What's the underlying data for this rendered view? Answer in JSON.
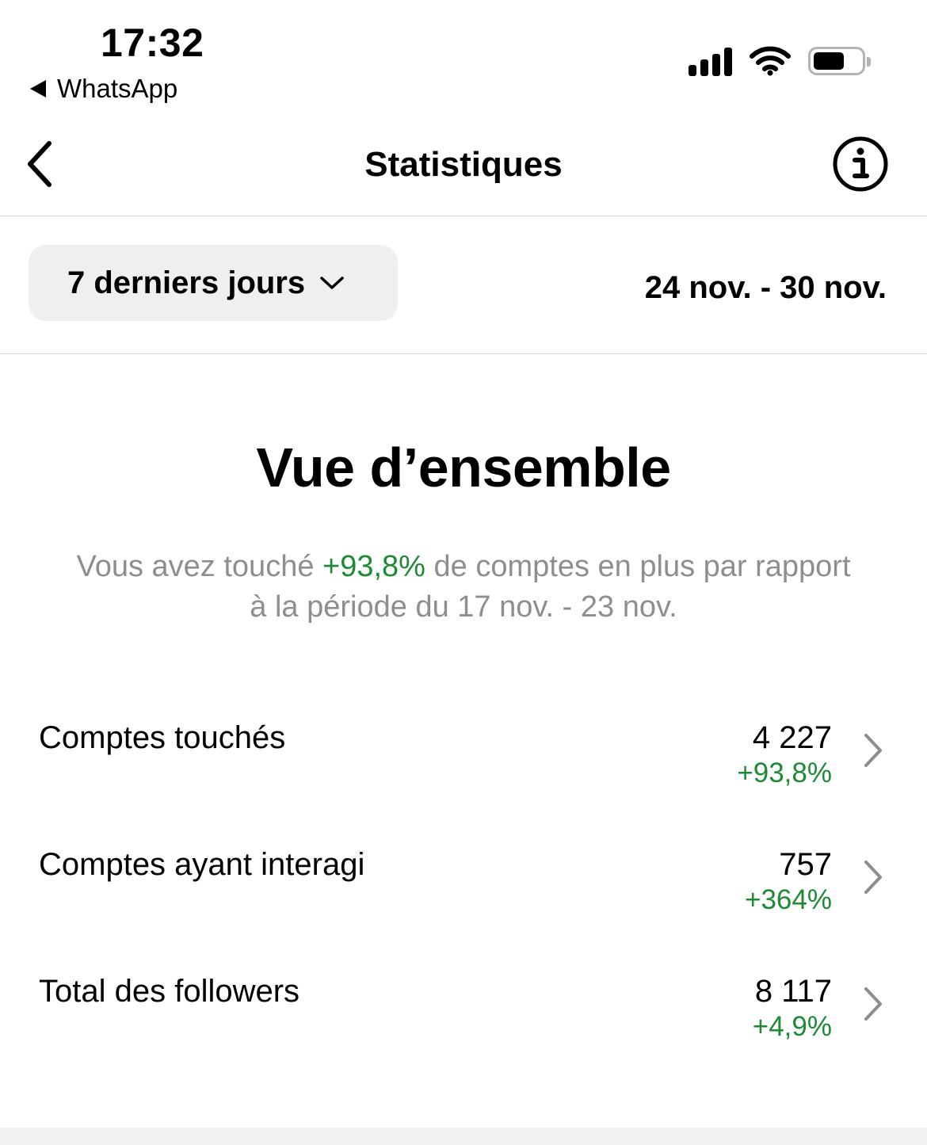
{
  "status_bar": {
    "time": "17:32",
    "back_app": "WhatsApp",
    "icons": [
      "cellular-signal-icon",
      "wifi-icon",
      "battery-icon"
    ],
    "battery_level": 0.6
  },
  "header": {
    "title": "Statistiques",
    "back_icon": "chevron-left-icon",
    "info_icon": "info-circle-icon"
  },
  "filter": {
    "period_label": "7 derniers jours",
    "date_range": "24 nov. - 30 nov."
  },
  "overview": {
    "title": "Vue d’ensemble",
    "summary_before": "Vous avez touché ",
    "summary_highlight": "+93,8%",
    "summary_after": " de comptes en plus par rapport à la période du 17 nov. - 23 nov."
  },
  "metrics": [
    {
      "label": "Comptes touchés",
      "value": "4 227",
      "change": "+93,8%"
    },
    {
      "label": "Comptes ayant interagi",
      "value": "757",
      "change": "+364%"
    },
    {
      "label": "Total des followers",
      "value": "8 117",
      "change": "+4,9%"
    }
  ],
  "colors": {
    "positive": "#1e8a34",
    "muted_text": "#8e8e8e",
    "chip_background": "#efefef",
    "divider": "#dbdbdb"
  }
}
